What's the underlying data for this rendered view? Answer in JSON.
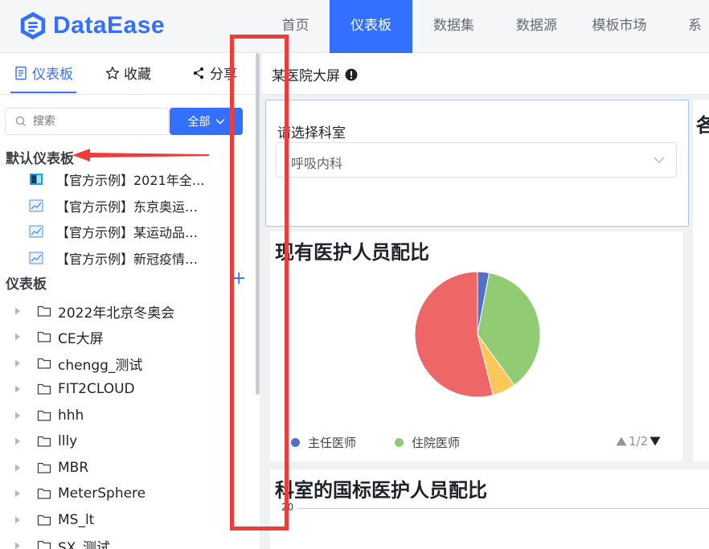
{
  "app": {
    "brand": "DataEase"
  },
  "nav": [
    {
      "label": "首页",
      "active": false
    },
    {
      "label": "仪表板",
      "active": true
    },
    {
      "label": "数据集",
      "active": false
    },
    {
      "label": "数据源",
      "active": false
    },
    {
      "label": "模板市场",
      "active": false
    },
    {
      "label": "系",
      "active": false
    }
  ],
  "sidebar": {
    "tabs": [
      {
        "label": "仪表板",
        "icon": "document-icon",
        "active": true
      },
      {
        "label": "收藏",
        "icon": "star-icon",
        "active": false
      },
      {
        "label": "分享",
        "icon": "share-icon",
        "active": false
      }
    ],
    "search": {
      "placeholder": "搜索"
    },
    "filter_label": "全部",
    "default_section": "默认仪表板",
    "default_items": [
      "【官方示例】2021年全…",
      "【官方示例】东京奥运…",
      "【官方示例】某运动品…",
      "【官方示例】新冠疫情…"
    ],
    "dashboard_section": "仪表板",
    "add_label": "+",
    "folders": [
      "2022年北京冬奥会",
      "CE大屏",
      "chengg_测试",
      "FIT2CLOUD",
      "hhh",
      "llly",
      "MBR",
      "MeterSphere",
      "MS_lt",
      "SX_测试"
    ]
  },
  "main": {
    "title": "某医院大屏",
    "filter": {
      "label": "请选择科室",
      "value": "呼吸内科"
    },
    "right_card_title": "各",
    "pie": {
      "title": "现有医护人员配比",
      "legend": [
        {
          "name": "主任医师",
          "color": "#5470c6"
        },
        {
          "name": "住院医师",
          "color": "#91cc75"
        }
      ],
      "pager": "1/2"
    },
    "bar": {
      "title": "科室的国标医护人员配比",
      "top_tick": "20"
    }
  },
  "chart_data": {
    "type": "pie",
    "title": "现有医护人员配比",
    "series": [
      {
        "name": "主任医师",
        "value": 3,
        "color": "#5470c6"
      },
      {
        "name": "住院医师",
        "value": 37,
        "color": "#91cc75"
      },
      {
        "name": "",
        "value": 6,
        "color": "#fac858"
      },
      {
        "name": "",
        "value": 54,
        "color": "#ee6666"
      }
    ]
  },
  "colors": {
    "accent": "#3370ff",
    "annotation": "#f03b3b"
  }
}
